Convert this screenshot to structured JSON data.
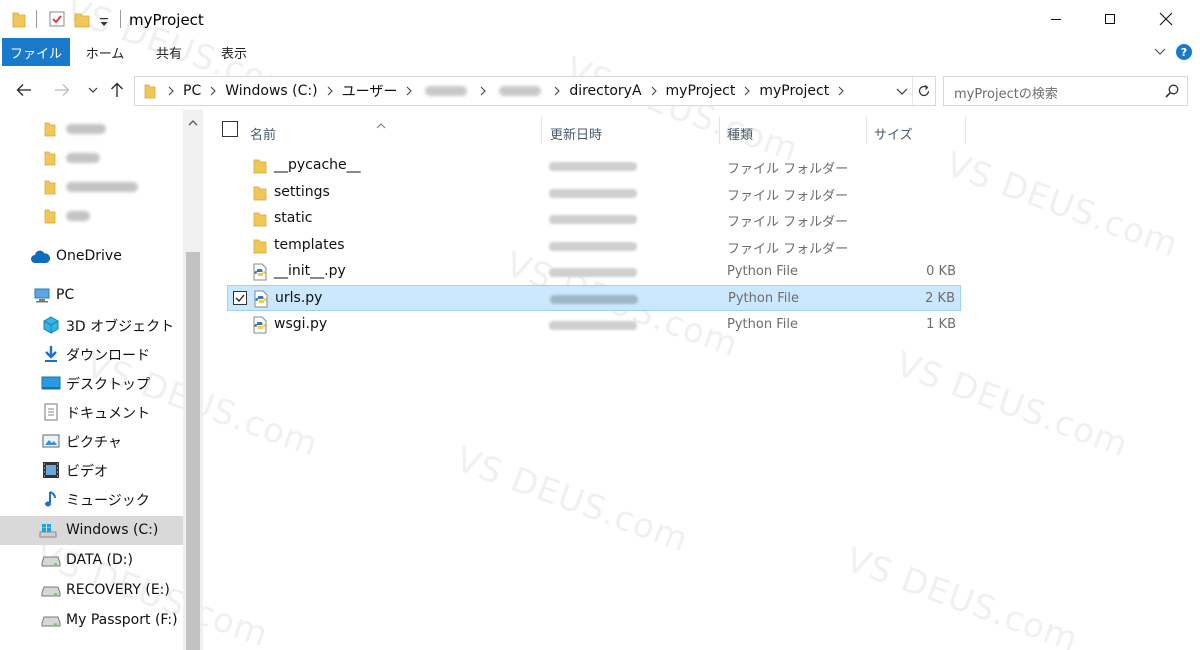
{
  "window": {
    "title": "myProject",
    "accent": "#1979ca",
    "selection_bg": "#cce8ff",
    "selection_border": "#99d1ff"
  },
  "quick_access_toolbar": [
    "folder-icon",
    "properties-check-icon",
    "new-folder-icon",
    "dropdown-arrow-icon"
  ],
  "ribbon": {
    "tabs": [
      "ファイル",
      "ホーム",
      "共有",
      "表示"
    ]
  },
  "address": {
    "crumbs": [
      "PC",
      "Windows (C:)",
      "ユーザー",
      "",
      "",
      "directoryA",
      "myProject",
      "myProject"
    ]
  },
  "search": {
    "placeholder": "myProjectの検索"
  },
  "nav": {
    "quick_items": [
      {
        "label": "",
        "icon": "folder-icon"
      },
      {
        "label": "",
        "icon": "folder-icon"
      },
      {
        "label": "",
        "icon": "folder-icon"
      },
      {
        "label": "",
        "icon": "folder-icon"
      }
    ],
    "onedrive": "OneDrive",
    "pc": "PC",
    "pc_items": [
      {
        "label": "3D オブジェクト",
        "icon": "3d-objects-icon"
      },
      {
        "label": "ダウンロード",
        "icon": "download-icon"
      },
      {
        "label": "デスクトップ",
        "icon": "desktop-icon"
      },
      {
        "label": "ドキュメント",
        "icon": "document-icon"
      },
      {
        "label": "ピクチャ",
        "icon": "pictures-icon"
      },
      {
        "label": "ビデオ",
        "icon": "video-icon"
      },
      {
        "label": "ミュージック",
        "icon": "music-icon"
      },
      {
        "label": "Windows (C:)",
        "icon": "windows-drive-icon",
        "selected": true
      },
      {
        "label": "DATA (D:)",
        "icon": "drive-icon"
      },
      {
        "label": "RECOVERY (E:)",
        "icon": "drive-icon"
      },
      {
        "label": "My Passport (F:)",
        "icon": "drive-icon"
      }
    ]
  },
  "columns": {
    "name": "名前",
    "date": "更新日時",
    "type": "種類",
    "size": "サイズ"
  },
  "files": [
    {
      "name": "__pycache__",
      "type": "ファイル フォルダー",
      "size": "",
      "icon": "folder-icon"
    },
    {
      "name": "settings",
      "type": "ファイル フォルダー",
      "size": "",
      "icon": "folder-icon"
    },
    {
      "name": "static",
      "type": "ファイル フォルダー",
      "size": "",
      "icon": "folder-icon"
    },
    {
      "name": "templates",
      "type": "ファイル フォルダー",
      "size": "",
      "icon": "folder-icon"
    },
    {
      "name": "__init__.py",
      "type": "Python File",
      "size": "0 KB",
      "icon": "python-file-icon"
    },
    {
      "name": "urls.py",
      "type": "Python File",
      "size": "2 KB",
      "icon": "python-file-icon",
      "selected": true,
      "checked": true
    },
    {
      "name": "wsgi.py",
      "type": "Python File",
      "size": "1 KB",
      "icon": "python-file-icon"
    }
  ],
  "watermark": "VS DEUS.com"
}
